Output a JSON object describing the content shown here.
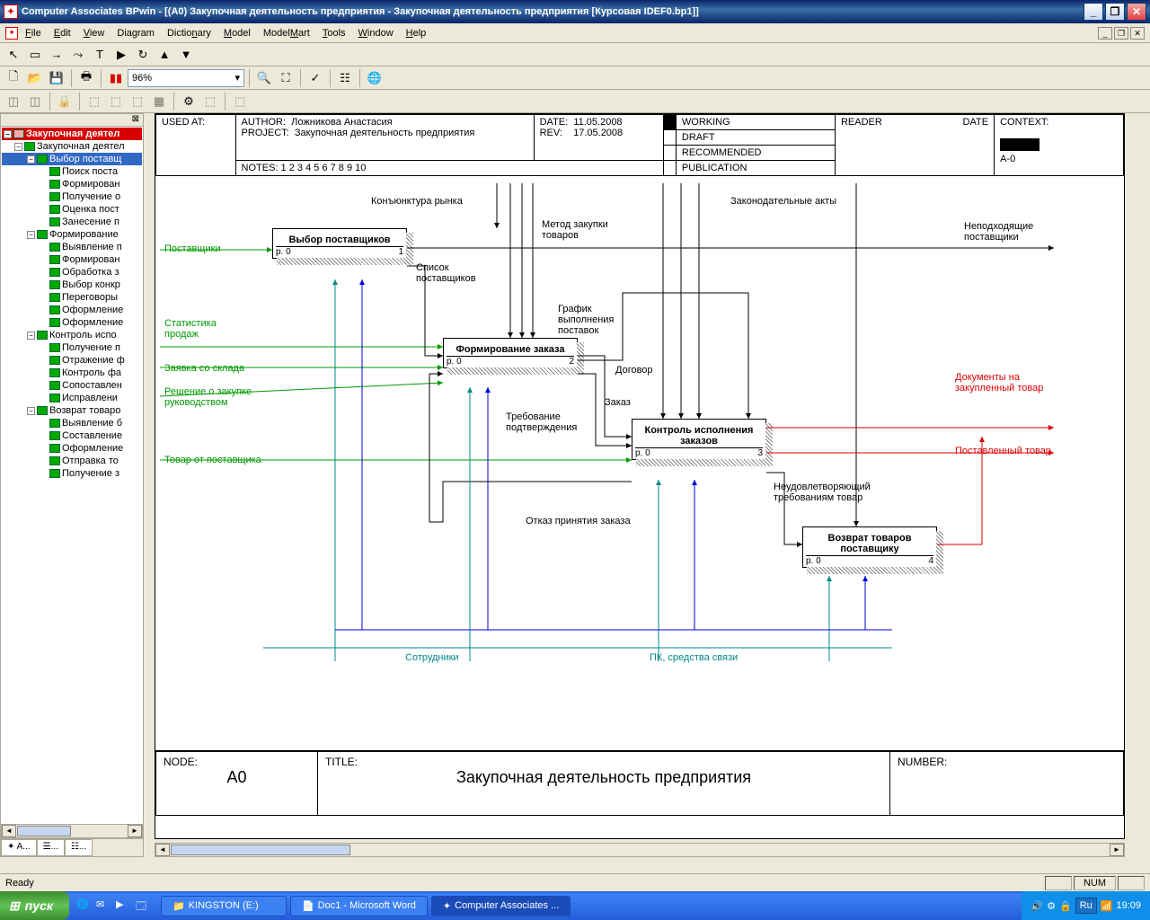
{
  "window": {
    "title": "Computer Associates BPwin - [(A0) Закупочная деятельность предприятия - Закупочная деятельность предприятия  [Курсовая IDEF0.bp1]]"
  },
  "menu": {
    "file": "File",
    "edit": "Edit",
    "view": "View",
    "diagram": "Diagram",
    "dictionary": "Dictionary",
    "model": "Model",
    "modelmart": "ModelMart",
    "tools": "Tools",
    "window": "Window",
    "help": "Help"
  },
  "zoom": "96%",
  "tree": {
    "root": "Закупочная деятел",
    "items": [
      {
        "l": 1,
        "t": "Закупочная деятел",
        "sel": false
      },
      {
        "l": 2,
        "t": "Выбор поставщ",
        "sel": true
      },
      {
        "l": 3,
        "t": "Поиск поста"
      },
      {
        "l": 3,
        "t": "Формирован"
      },
      {
        "l": 3,
        "t": "Получение о"
      },
      {
        "l": 3,
        "t": "Оценка пост"
      },
      {
        "l": 3,
        "t": "Занесение п"
      },
      {
        "l": 2,
        "t": "Формирование"
      },
      {
        "l": 3,
        "t": "Выявление п"
      },
      {
        "l": 3,
        "t": "Формирован"
      },
      {
        "l": 3,
        "t": "Обработка з"
      },
      {
        "l": 3,
        "t": "Выбор конкр"
      },
      {
        "l": 3,
        "t": "Переговоры"
      },
      {
        "l": 3,
        "t": "Оформление"
      },
      {
        "l": 3,
        "t": "Оформление"
      },
      {
        "l": 2,
        "t": "Контроль испо"
      },
      {
        "l": 3,
        "t": "Получение п"
      },
      {
        "l": 3,
        "t": "Отражение ф"
      },
      {
        "l": 3,
        "t": "Контроль фа"
      },
      {
        "l": 3,
        "t": "Сопоставлен"
      },
      {
        "l": 3,
        "t": "Исправлени"
      },
      {
        "l": 2,
        "t": "Возврат товаро"
      },
      {
        "l": 3,
        "t": "Выявление б"
      },
      {
        "l": 3,
        "t": "Составление"
      },
      {
        "l": 3,
        "t": "Оформление"
      },
      {
        "l": 3,
        "t": "Отправка то"
      },
      {
        "l": 3,
        "t": "Получение з"
      }
    ]
  },
  "header": {
    "used_at": "USED AT:",
    "author_lbl": "AUTHOR:",
    "author": "Ложникова Анастасия",
    "project_lbl": "PROJECT:",
    "project": "Закупочная деятельность предприятия",
    "date_lbl": "DATE:",
    "date": "11.05.2008",
    "rev_lbl": "REV:",
    "rev": "17.05.2008",
    "notes": "NOTES:  1  2  3  4  5  6  7  8  9  10",
    "working": "WORKING",
    "draft": "DRAFT",
    "recommended": "RECOMMENDED",
    "publication": "PUBLICATION",
    "reader": "READER",
    "rdate": "DATE",
    "context": "CONTEXT:",
    "context_id": "A-0"
  },
  "activities": {
    "a1": {
      "title": "Выбор поставщиков",
      "p": "р. 0",
      "n": "1"
    },
    "a2": {
      "title": "Формирование заказа",
      "p": "р. 0",
      "n": "2"
    },
    "a3": {
      "title": "Контроль исполнения заказов",
      "p": "р. 0",
      "n": "3"
    },
    "a4": {
      "title": "Возврат товаров поставщику",
      "p": "р. 0",
      "n": "4"
    }
  },
  "labels": {
    "postavshiki": "Поставщики",
    "statistika": "Статистика продаж",
    "zayavka": "Заявка со склада",
    "reshenie": "Решение о закупке руководством",
    "tovar_ot": "Товар от поставщика",
    "konyunktura": "Конъюнктура рынка",
    "zakonodat": "Законодательные акты",
    "metod": "Метод закупки товаров",
    "spisok": "Список поставщиков",
    "grafik": "График выполнения поставок",
    "dogovor": "Договор",
    "zakaz": "Заказ",
    "trebovanie": "Требование подтверждения",
    "otkaz": "Отказ принятия заказа",
    "neud": "Неудовлетворяющий требованиям товар",
    "nepod": "Неподходящие поставщики",
    "dokumenty": "Документы на закупленный товар",
    "postavlenny": "Поставленный товар",
    "sotrudniki": "Сотрудники",
    "pk": "ПК, средства связи"
  },
  "footer": {
    "node_lbl": "NODE:",
    "node": "A0",
    "title_lbl": "TITLE:",
    "title": "Закупочная деятельность предприятия",
    "number_lbl": "NUMBER:"
  },
  "status": {
    "ready": "Ready",
    "num": "NUM"
  },
  "taskbar": {
    "start": "пуск",
    "kingston": "KINGSTON (E:)",
    "doc": "Doc1 - Microsoft Word",
    "bpwin": "Computer Associates ...",
    "lang": "Ru",
    "time": "19:09"
  },
  "sidetab": "A..."
}
